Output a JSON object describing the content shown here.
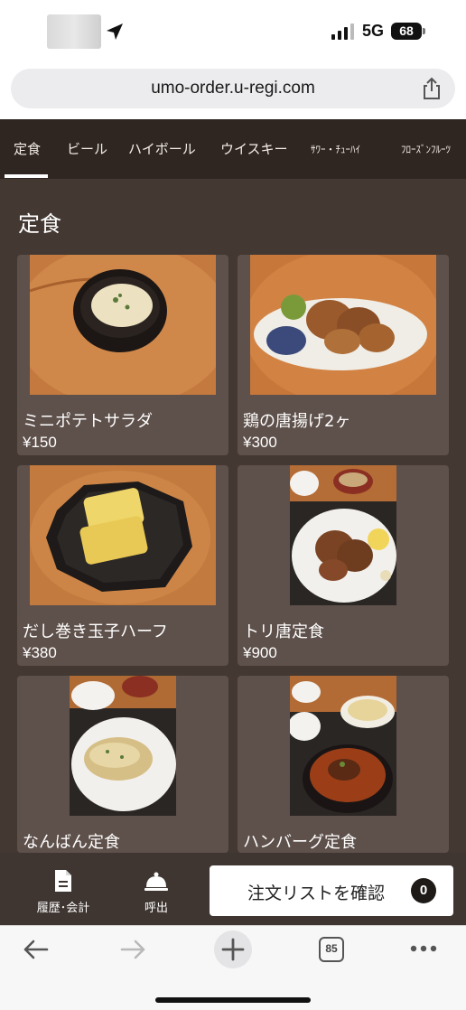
{
  "status_bar": {
    "network": "5G",
    "battery": "68"
  },
  "browser": {
    "url": "umo-order.u-regi.com",
    "tab_count": "85"
  },
  "categories": [
    {
      "label": "定食",
      "active": true
    },
    {
      "label": "ビール",
      "active": false
    },
    {
      "label": "ハイボール",
      "active": false
    },
    {
      "label": "ウイスキー",
      "active": false
    },
    {
      "label": "ｻﾜｰ・ﾁｭｰﾊｲ",
      "active": false
    },
    {
      "label": "ﾌﾛｰｽﾞﾝﾌﾙｰﾂ",
      "active": false
    }
  ],
  "section": {
    "title": "定食"
  },
  "menu_items": [
    {
      "name": "ミニポテトサラダ",
      "price": "¥150"
    },
    {
      "name": "鶏の唐揚げ2ヶ",
      "price": "¥300"
    },
    {
      "name": "だし巻き玉子ハーフ",
      "price": "¥380"
    },
    {
      "name": "トリ唐定食",
      "price": "¥900"
    },
    {
      "name": "なんばん定食",
      "price": ""
    },
    {
      "name": "ハンバーグ定食",
      "price": ""
    }
  ],
  "actions": {
    "history_label": "履歴･会計",
    "call_label": "呼出",
    "order_list_label": "注文リストを確認",
    "order_count": "0"
  },
  "colors": {
    "background": "#433832",
    "card": "#5e504a",
    "tab_bar": "#2f2622",
    "action_bar": "#3f3632"
  }
}
